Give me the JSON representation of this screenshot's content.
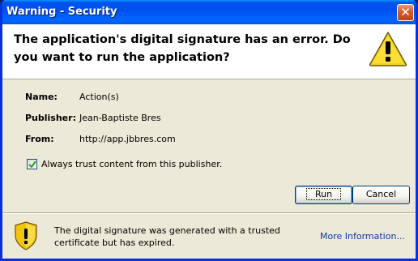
{
  "window": {
    "title": "Warning - Security",
    "close_glyph": "✕"
  },
  "header": {
    "message": "The application's digital signature has an error.  Do you want to run the application?",
    "icon": "warning-triangle-icon"
  },
  "details": [
    {
      "label": "Name:",
      "value": "Action(s)"
    },
    {
      "label": "Publisher:",
      "value": "Jean-Baptiste Bres"
    },
    {
      "label": "From:",
      "value": "http://app.jbbres.com"
    }
  ],
  "trust_checkbox": {
    "label": "Always trust content from this publisher.",
    "checked": true
  },
  "buttons": {
    "run": "Run",
    "cancel": "Cancel"
  },
  "footer": {
    "message": "The digital signature was generated with a trusted certificate but has expired.",
    "link": "More Information...",
    "icon": "warning-shield-icon"
  },
  "colors": {
    "titlebar": "#0053ee",
    "window_bg": "#ece9d8",
    "link": "#0d3b9e",
    "warning_yellow": "#ffd700"
  }
}
